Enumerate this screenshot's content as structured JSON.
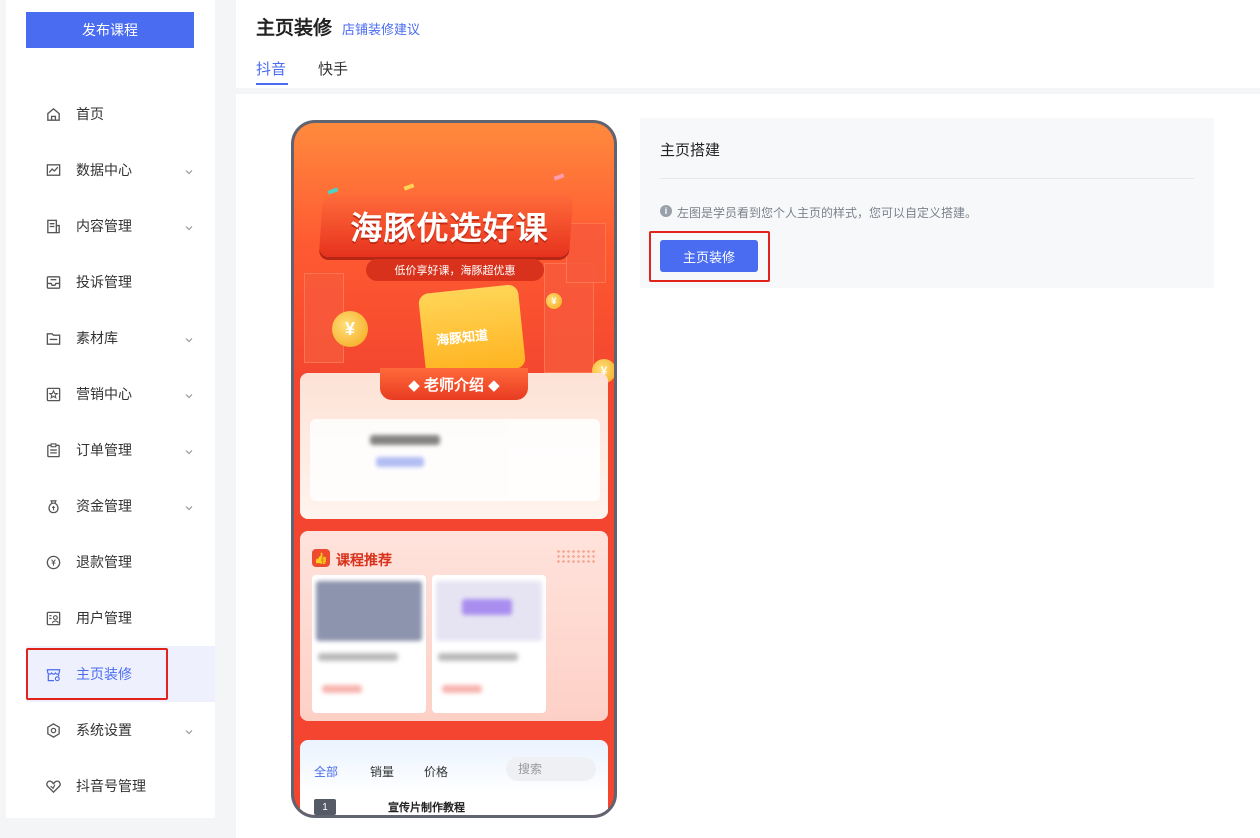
{
  "sidebar": {
    "publish_label": "发布课程",
    "items": [
      {
        "label": "首页",
        "icon": "home-icon",
        "has_submenu": false,
        "active": false
      },
      {
        "label": "数据中心",
        "icon": "chart-icon",
        "has_submenu": true,
        "active": false
      },
      {
        "label": "内容管理",
        "icon": "document-icon",
        "has_submenu": true,
        "active": false
      },
      {
        "label": "投诉管理",
        "icon": "inbox-icon",
        "has_submenu": false,
        "active": false
      },
      {
        "label": "素材库",
        "icon": "folder-icon",
        "has_submenu": true,
        "active": false
      },
      {
        "label": "营销中心",
        "icon": "star-icon",
        "has_submenu": true,
        "active": false
      },
      {
        "label": "订单管理",
        "icon": "clipboard-icon",
        "has_submenu": true,
        "active": false
      },
      {
        "label": "资金管理",
        "icon": "money-bag-icon",
        "has_submenu": true,
        "active": false
      },
      {
        "label": "退款管理",
        "icon": "refund-icon",
        "has_submenu": false,
        "active": false
      },
      {
        "label": "用户管理",
        "icon": "user-icon",
        "has_submenu": false,
        "active": false
      },
      {
        "label": "主页装修",
        "icon": "storefront-icon",
        "has_submenu": false,
        "active": true
      },
      {
        "label": "系统设置",
        "icon": "settings-icon",
        "has_submenu": true,
        "active": false
      },
      {
        "label": "抖音号管理",
        "icon": "heart-icon",
        "has_submenu": false,
        "active": false
      }
    ]
  },
  "header": {
    "title": "主页装修",
    "link": "店铺装修建议",
    "tabs": [
      "抖音",
      "快手"
    ],
    "active_tab": "抖音"
  },
  "phone": {
    "hero_title": "海豚优选好课",
    "hero_subtitle": "低价享好课，海豚超优惠",
    "gift_label": "海豚知道",
    "teacher_section": "老师介绍",
    "course_section": "课程推荐",
    "filter_tabs": [
      "全部",
      "销量",
      "价格"
    ],
    "search_placeholder": "搜索",
    "first_rank": "1",
    "first_course": "宣传片制作教程"
  },
  "panel": {
    "title": "主页搭建",
    "tip": "左图是学员看到您个人主页的样式，您可以自定义搭建。",
    "button": "主页装修"
  },
  "colors": {
    "accent": "#4a6cf0",
    "highlight": "#e0241b",
    "hero": "#f3452f"
  }
}
